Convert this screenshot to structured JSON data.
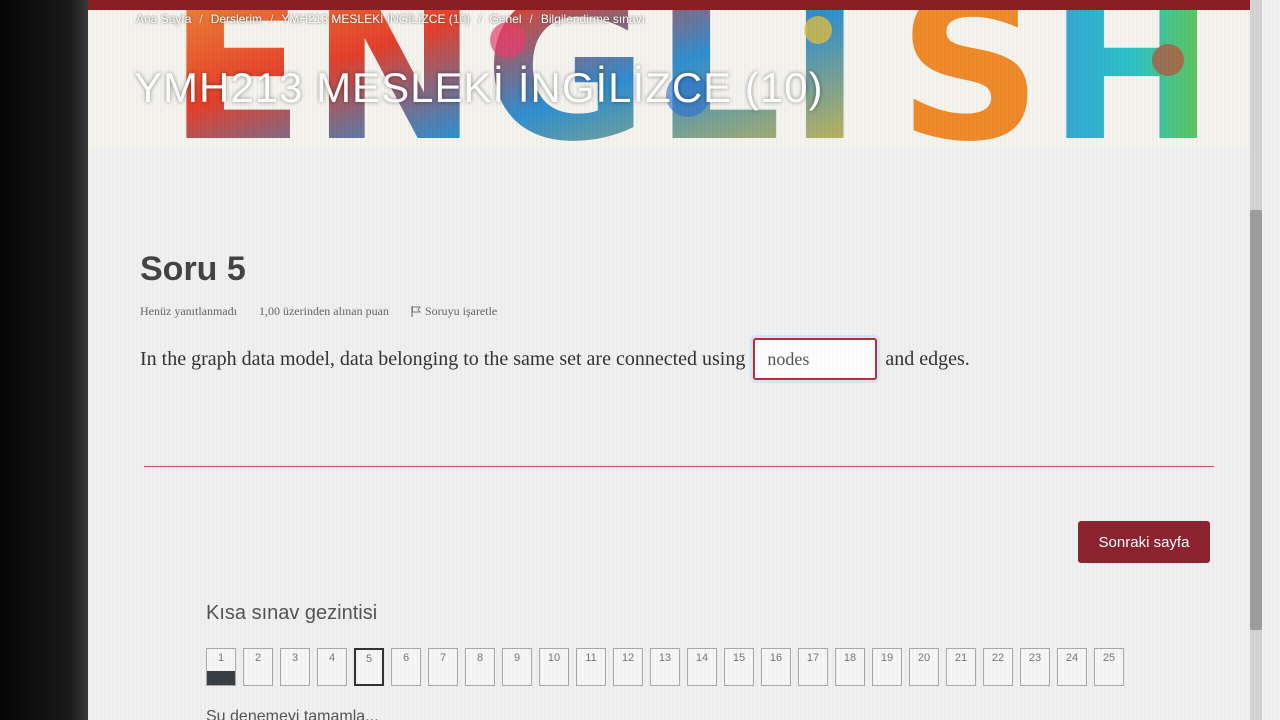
{
  "breadcrumb": [
    "Ana Sayfa",
    "Derslerim",
    "YMH213 MESLEKİ İNGİLİZCE (10)",
    "Genel",
    "Bilgilendirme sınavı"
  ],
  "course": {
    "title": "YMH213 MESLEKİ İNGİLİZCE (10)",
    "banner_text": "ENGLISH"
  },
  "question": {
    "title": "Soru 5",
    "status": "Henüz yanıtlanmadı",
    "points": "1,00 üzerinden alınan puan",
    "flag_label": "Soruyu işaretle",
    "text_before": "In the graph data model, data belonging to the same set are connected using",
    "answer_value": "nodes",
    "text_after": "and edges."
  },
  "next_button": "Sonraki sayfa",
  "nav": {
    "title": "Kısa sınav gezintisi",
    "buttons": [
      "1",
      "2",
      "3",
      "4",
      "5",
      "6",
      "7",
      "8",
      "9",
      "10",
      "11",
      "12",
      "13",
      "14",
      "15",
      "16",
      "17",
      "18",
      "19",
      "20",
      "21",
      "22",
      "23",
      "24",
      "25"
    ],
    "current": 5,
    "answered": [
      1
    ]
  },
  "finish_link": "Şu denemeyi tamamla...",
  "colors": {
    "accent": "#8e2330",
    "input_border": "#b3303a",
    "banner_top": "#8a1f23"
  }
}
